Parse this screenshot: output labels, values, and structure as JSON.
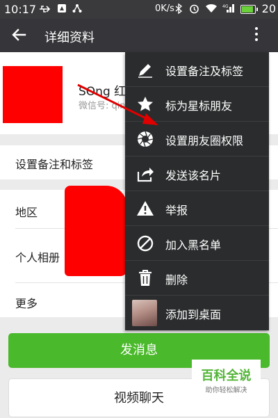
{
  "status_bar": {
    "time": "10:17",
    "network_speed": "0K/s",
    "battery_level": "20",
    "icons": [
      "usb-icon",
      "notification-icon",
      "share-icon",
      "bluetooth-icon",
      "alarm-icon",
      "wifi-icon",
      "signal-4g-icon",
      "battery-icon"
    ]
  },
  "app_bar": {
    "title": "详细资料"
  },
  "profile": {
    "name": "SOng 红琴",
    "wechat_id_label": "微信号: qin"
  },
  "rows": [
    {
      "label": "设置备注和标签"
    },
    {
      "label": "地区"
    },
    {
      "label": "个人相册"
    },
    {
      "label": "更多"
    }
  ],
  "menu": {
    "items": [
      {
        "label": "设置备注及标签",
        "icon": "pencil-icon"
      },
      {
        "label": "标为星标朋友",
        "icon": "star-icon"
      },
      {
        "label": "设置朋友圈权限",
        "icon": "aperture-icon"
      },
      {
        "label": "发送该名片",
        "icon": "share-card-icon"
      },
      {
        "label": "举报",
        "icon": "warning-icon"
      },
      {
        "label": "加入黑名单",
        "icon": "block-icon"
      },
      {
        "label": "删除",
        "icon": "trash-icon"
      },
      {
        "label": "添加到桌面",
        "icon": "avatar-thumbnail"
      }
    ]
  },
  "buttons": {
    "send_message": "发消息",
    "video_chat": "视频聊天"
  },
  "watermark": {
    "title": "百科全说",
    "subtitle": "助你轻松解决"
  },
  "colors": {
    "accent_green": "#4ab92b",
    "menu_bg": "#2a2c2d",
    "app_bar": "#36363a",
    "redaction": "#ff0000"
  }
}
